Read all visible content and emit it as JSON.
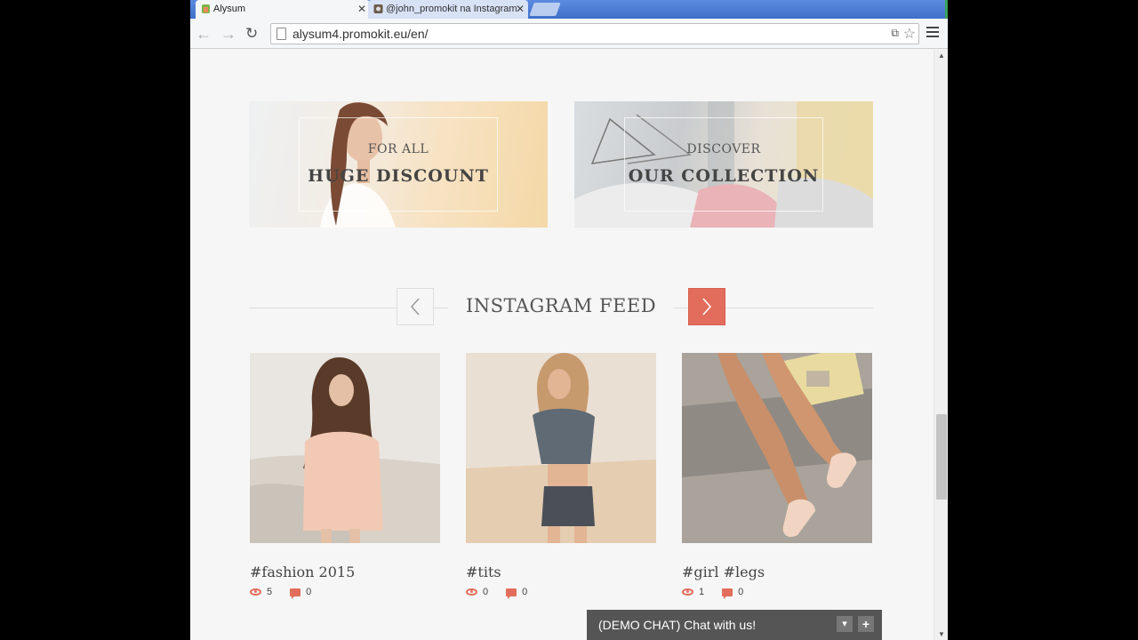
{
  "browser": {
    "tabs": [
      {
        "label": "Alysum",
        "active": true
      },
      {
        "label": "@john_promokit na Instagram",
        "active": false
      }
    ],
    "url": "alysum4.promokit.eu/en/"
  },
  "banners": [
    {
      "kicker": "FOR ALL",
      "headline": "HUGE DISCOUNT"
    },
    {
      "kicker": "DISCOVER",
      "headline": "OUR COLLECTION"
    }
  ],
  "instagram": {
    "title": "INSTAGRAM FEED",
    "items": [
      {
        "caption": "#fashion 2015",
        "views": "5",
        "comments": "0"
      },
      {
        "caption": "#tits",
        "views": "0",
        "comments": "0"
      },
      {
        "caption": "#girl #legs",
        "views": "1",
        "comments": "0"
      }
    ]
  },
  "chat": {
    "label": "(DEMO CHAT) Chat with us!"
  },
  "colors": {
    "accent": "#e26d5c",
    "chat_bg": "#555555",
    "tab_strip": "#4a7ad0"
  }
}
